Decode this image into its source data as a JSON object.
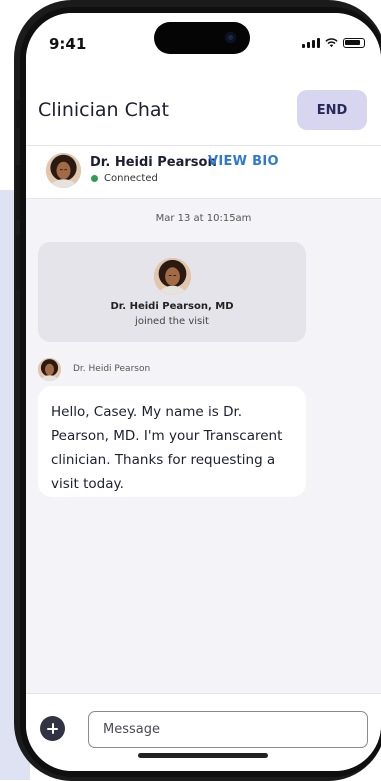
{
  "status_bar": {
    "time": "9:41"
  },
  "header": {
    "title": "Clinician Chat",
    "end_label": "END"
  },
  "clinician": {
    "name": "Dr. Heidi Pearson",
    "view_bio_label": "VIEW BIO",
    "status": "Connected",
    "status_color": "#2e9c54"
  },
  "chat": {
    "timestamp": "Mar 13 at 10:15am",
    "joined_card": {
      "name": "Dr. Heidi Pearson, MD",
      "subtitle": "joined the visit"
    },
    "messages": [
      {
        "sender": "Dr. Heidi Pearson",
        "text": "Hello, Casey. My name is Dr. Pearson, MD. I'm your Transcarent clinician. Thanks for requesting a visit today."
      }
    ]
  },
  "composer": {
    "placeholder": "Message",
    "add_icon": "plus-circle-icon"
  },
  "colors": {
    "accent": "#2d78d6",
    "end_button_bg": "#d7d5f0",
    "chat_background": "#f4f4f8"
  }
}
